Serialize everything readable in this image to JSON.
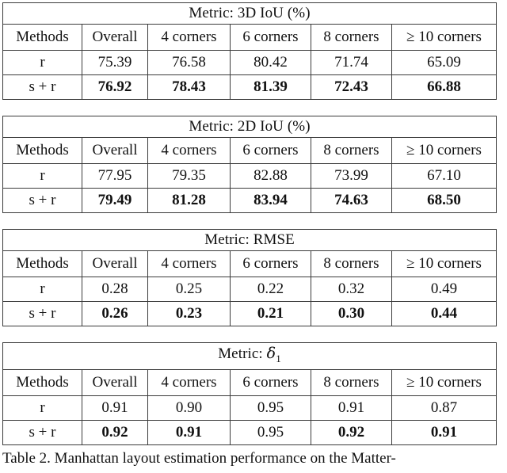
{
  "document": {
    "caption": "Table 2. Manhattan layout estimation performance on the Matter-"
  },
  "columns": [
    "Methods",
    "Overall",
    "4 corners",
    "6 corners",
    "8 corners",
    "≥ 10 corners"
  ],
  "tables": [
    {
      "title": "Metric: 3D IoU (%)",
      "headers": [
        "Methods",
        "Overall",
        "4 corners",
        "6 corners",
        "8 corners",
        "≥ 10 corners"
      ],
      "rows": [
        {
          "label": "r",
          "bold": false,
          "values": [
            "75.39",
            "76.58",
            "80.42",
            "71.74",
            "65.09"
          ],
          "value_bold": [
            false,
            false,
            false,
            false,
            false
          ]
        },
        {
          "label": "s + r",
          "bold": true,
          "values": [
            "76.92",
            "78.43",
            "81.39",
            "72.43",
            "66.88"
          ],
          "value_bold": [
            true,
            true,
            true,
            true,
            true
          ]
        }
      ]
    },
    {
      "title": "Metric: 2D IoU (%)",
      "headers": [
        "Methods",
        "Overall",
        "4 corners",
        "6 corners",
        "8 corners",
        "≥ 10 corners"
      ],
      "rows": [
        {
          "label": "r",
          "bold": false,
          "values": [
            "77.95",
            "79.35",
            "82.88",
            "73.99",
            "67.10"
          ],
          "value_bold": [
            false,
            false,
            false,
            false,
            false
          ]
        },
        {
          "label": "s + r",
          "bold": true,
          "values": [
            "79.49",
            "81.28",
            "83.94",
            "74.63",
            "68.50"
          ],
          "value_bold": [
            true,
            true,
            true,
            true,
            true
          ]
        }
      ]
    },
    {
      "title": "Metric: RMSE",
      "headers": [
        "Methods",
        "Overall",
        "4 corners",
        "6 corners",
        "8 corners",
        "≥ 10 corners"
      ],
      "rows": [
        {
          "label": "r",
          "bold": false,
          "values": [
            "0.28",
            "0.25",
            "0.22",
            "0.32",
            "0.49"
          ],
          "value_bold": [
            false,
            false,
            false,
            false,
            false
          ]
        },
        {
          "label": "s + r",
          "bold": true,
          "values": [
            "0.26",
            "0.23",
            "0.21",
            "0.30",
            "0.44"
          ],
          "value_bold": [
            true,
            true,
            true,
            true,
            true
          ]
        }
      ]
    },
    {
      "title_prefix": "Metric: ",
      "title_symbol": "δ",
      "title_subscript": "1",
      "title": "Metric: δ1",
      "headers": [
        "Methods",
        "Overall",
        "4 corners",
        "6 corners",
        "8 corners",
        "≥ 10 corners"
      ],
      "rows": [
        {
          "label": "r",
          "bold": false,
          "values": [
            "0.91",
            "0.90",
            "0.95",
            "0.91",
            "0.87"
          ],
          "value_bold": [
            false,
            false,
            false,
            false,
            false
          ]
        },
        {
          "label": "s + r",
          "bold": true,
          "values": [
            "0.92",
            "0.91",
            "0.95",
            "0.92",
            "0.91"
          ],
          "value_bold": [
            true,
            true,
            false,
            true,
            true
          ]
        }
      ]
    }
  ],
  "style": {
    "border_color": "#3b3b3b",
    "text_color": "#111111",
    "background": "#ffffff"
  }
}
